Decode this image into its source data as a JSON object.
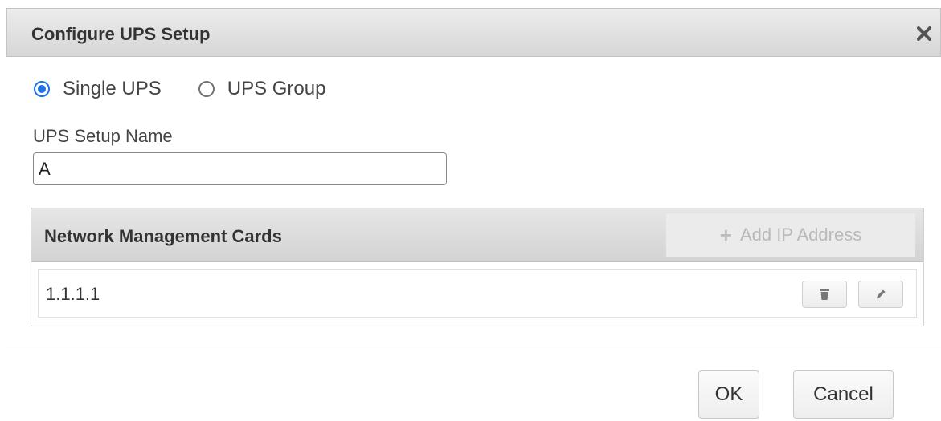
{
  "dialog": {
    "title": "Configure UPS Setup",
    "close_icon": "close-icon"
  },
  "mode": {
    "options": [
      {
        "label": "Single UPS",
        "checked": true
      },
      {
        "label": "UPS Group",
        "checked": false
      }
    ]
  },
  "setup_name": {
    "label": "UPS Setup Name",
    "value": "A"
  },
  "cards": {
    "title": "Network Management Cards",
    "add_button": {
      "label": "Add IP Address",
      "icon": "plus-icon",
      "enabled": false
    },
    "rows": [
      {
        "ip": "1.1.1.1",
        "delete_icon": "trash-icon",
        "edit_icon": "pencil-icon"
      }
    ]
  },
  "footer": {
    "ok_label": "OK",
    "cancel_label": "Cancel"
  },
  "colors": {
    "radio_accent": "#1a73e8",
    "header_bg": "#dcdcdc",
    "disabled_text": "#b9b9b9"
  }
}
